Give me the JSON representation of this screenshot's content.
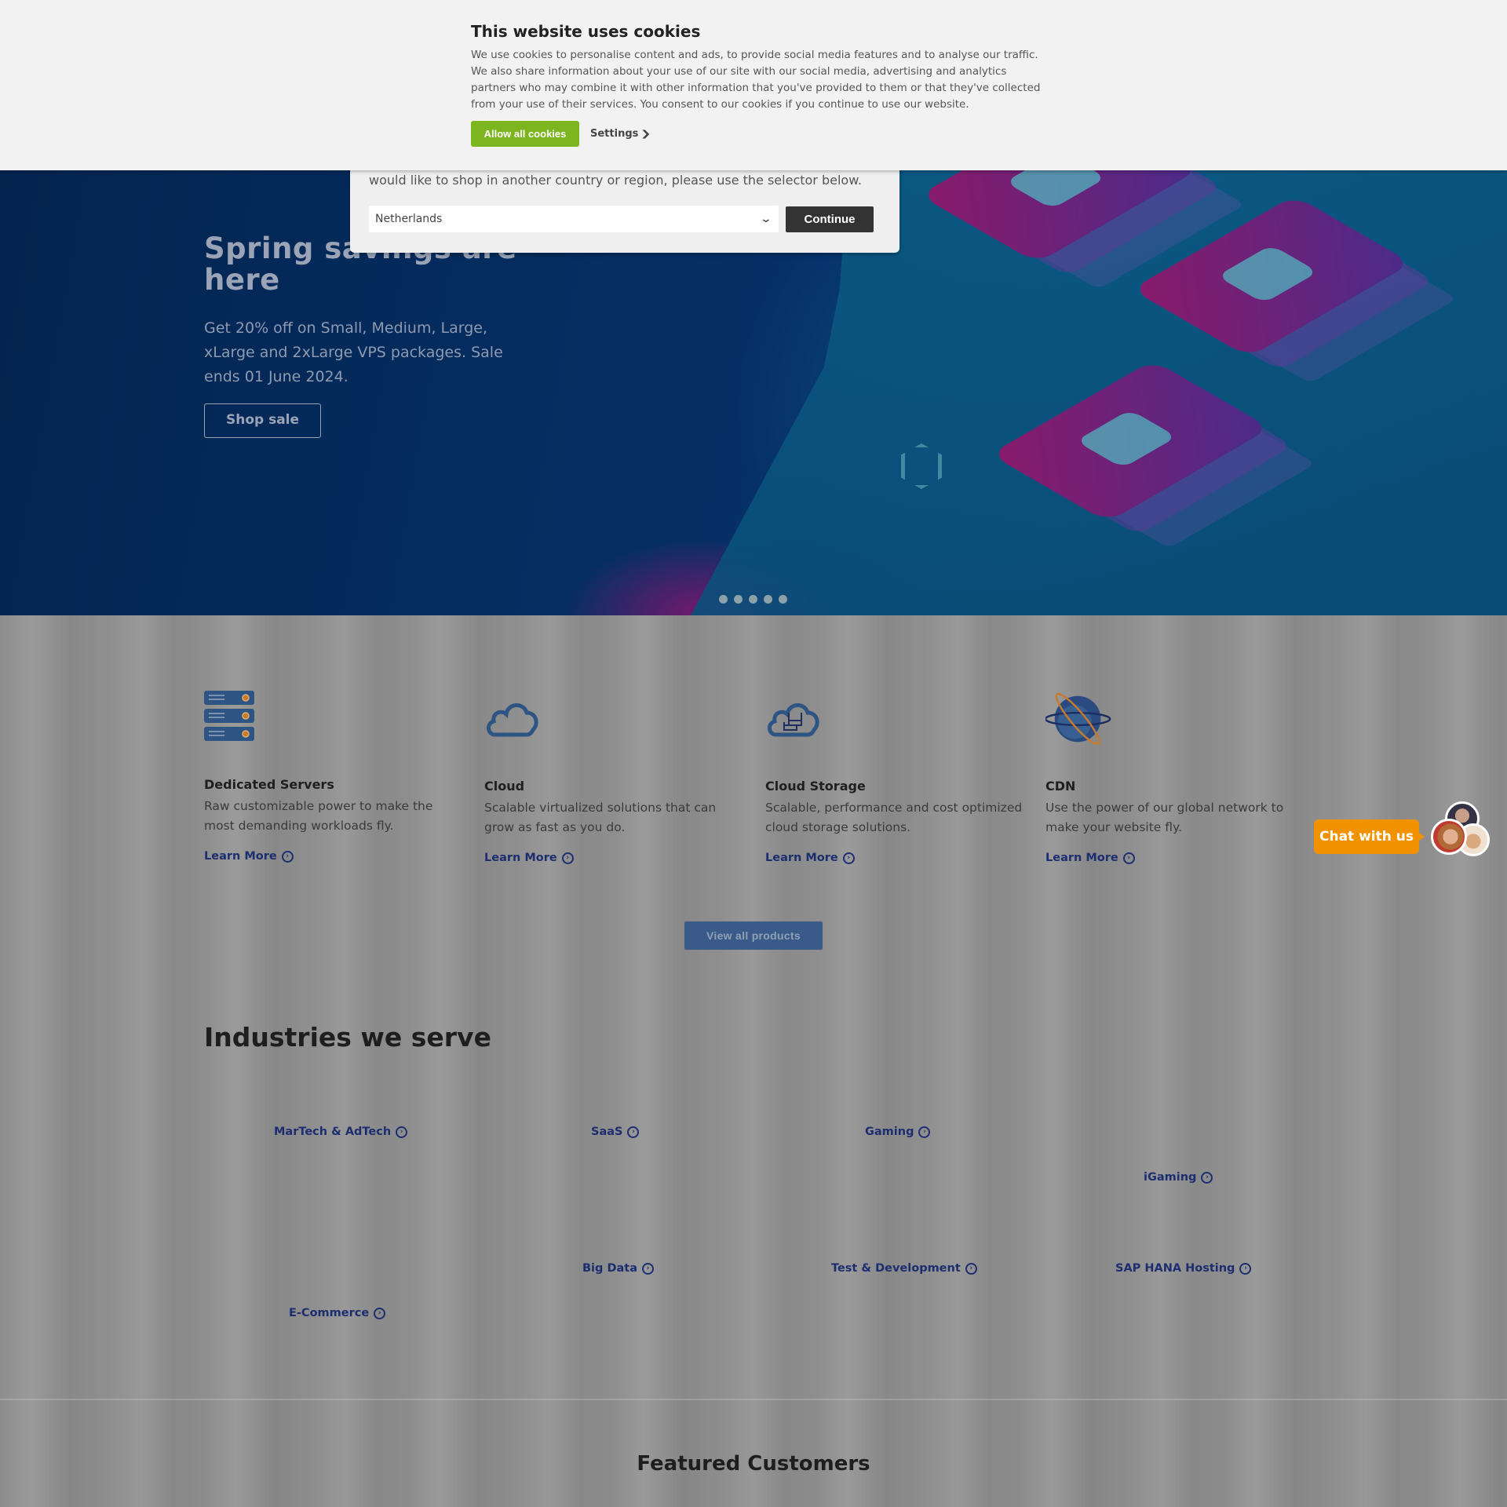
{
  "cookie_banner": {
    "title": "This website uses cookies",
    "text": "We use cookies to personalise content and ads, to provide social media features and to analyse our traffic. We also share information about your use of our site with our social media, advertising and analytics partners who may combine it with other information that you've provided to them or that they've collected from your use of their services. You consent to our cookies if you continue to use our website.",
    "allow_label": "Allow all cookies",
    "settings_label": "Settings",
    "accent_color": "#7cb51f"
  },
  "country_modal": {
    "text": "would like to shop in another country or region, please use the selector below.",
    "selected_country": "Netherlands",
    "continue_label": "Continue"
  },
  "hero": {
    "title": "Spring savings are here",
    "text": "Get 20% off on Small, Medium, Large, xLarge and 2xLarge VPS packages. Sale ends 01 June 2024.",
    "button_label": "Shop sale",
    "slides_count": 5
  },
  "products": [
    {
      "icon": "server-rack-icon",
      "title": "Dedicated Servers",
      "desc": "Raw customizable power to make the most demanding workloads fly.",
      "link": "Learn More"
    },
    {
      "icon": "cloud-icon",
      "title": "Cloud",
      "desc": "Scalable virtualized solutions that can grow as fast as you do.",
      "link": "Learn More"
    },
    {
      "icon": "cloud-storage-icon",
      "title": "Cloud Storage",
      "desc": "Scalable, performance and cost optimized cloud storage solutions.",
      "link": "Learn More"
    },
    {
      "icon": "globe-network-icon",
      "title": "CDN",
      "desc": "Use the power of our global network to make your website fly.",
      "link": "Learn More"
    }
  ],
  "view_all_label": "View all products",
  "industries": {
    "title": "Industries we serve",
    "items": [
      "MarTech & AdTech",
      "SaaS",
      "Gaming",
      "iGaming",
      "E-Commerce",
      "Big Data",
      "Test & Development",
      "SAP HANA Hosting"
    ]
  },
  "featured_title": "Featured Customers",
  "chat": {
    "label": "Chat with us",
    "color": "#f39200"
  }
}
